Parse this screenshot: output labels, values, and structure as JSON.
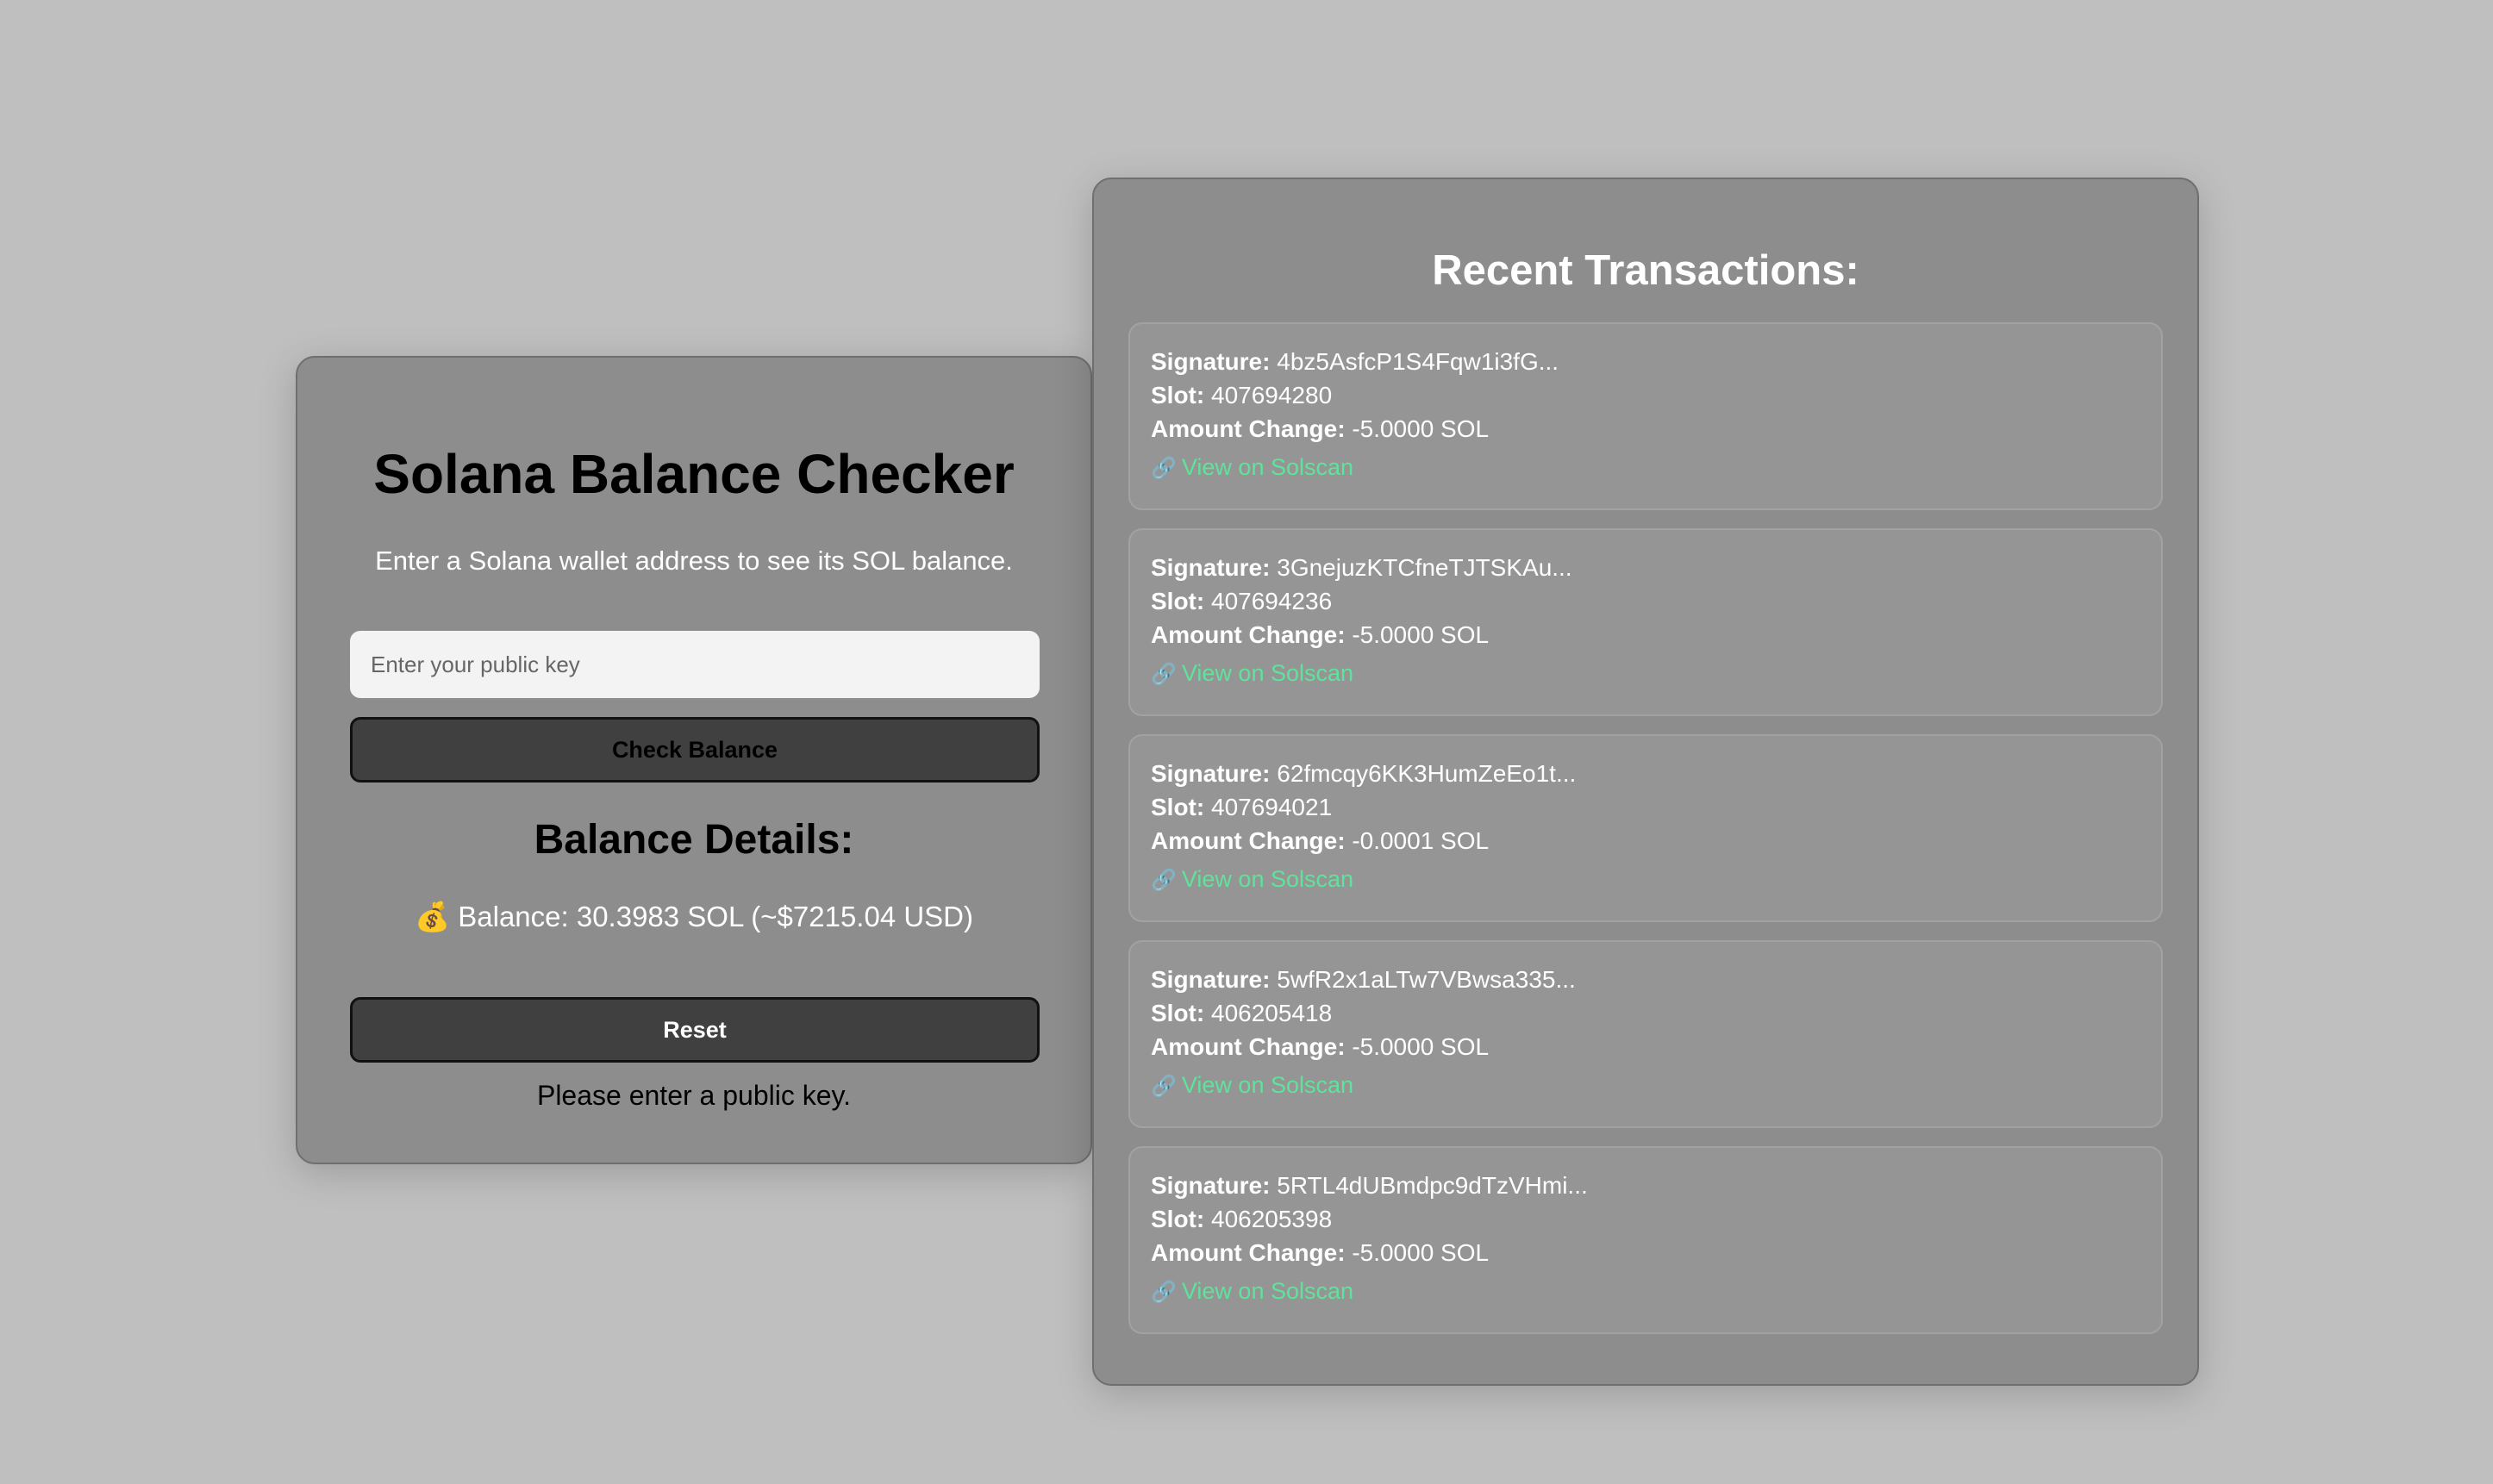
{
  "app": {
    "title": "Solana Balance Checker",
    "subtitle": "Enter a Solana wallet address to see its SOL balance.",
    "input_placeholder": "Enter your public key",
    "check_button": "Check Balance",
    "details_heading": "Balance Details:",
    "balance_icon": "💰",
    "balance_text": "Balance: 30.3983 SOL (~$7215.04 USD)",
    "reset_button": "Reset",
    "status_message": "Please enter a public key."
  },
  "transactions": {
    "heading": "Recent Transactions:",
    "labels": {
      "signature": "Signature:",
      "slot": "Slot:",
      "amount": "Amount Change:"
    },
    "link_icon": "🔗",
    "link_text": "View on Solscan",
    "items": [
      {
        "signature": "4bz5AsfcP1S4Fqw1i3fG...",
        "slot": "407694280",
        "amount": "-5.0000 SOL"
      },
      {
        "signature": "3GnejuzKTCfneTJTSKAu...",
        "slot": "407694236",
        "amount": "-5.0000 SOL"
      },
      {
        "signature": "62fmcqy6KK3HumZeEo1t...",
        "slot": "407694021",
        "amount": "-0.0001 SOL"
      },
      {
        "signature": "5wfR2x1aLTw7VBwsa335...",
        "slot": "406205418",
        "amount": "-5.0000 SOL"
      },
      {
        "signature": "5RTL4dUBmdpc9dTzVHmi...",
        "slot": "406205398",
        "amount": "-5.0000 SOL"
      }
    ]
  },
  "colors": {
    "background": "#bfbfbf",
    "panel": "#8d8d8d",
    "button": "#404040",
    "link": "#5fe39a"
  }
}
